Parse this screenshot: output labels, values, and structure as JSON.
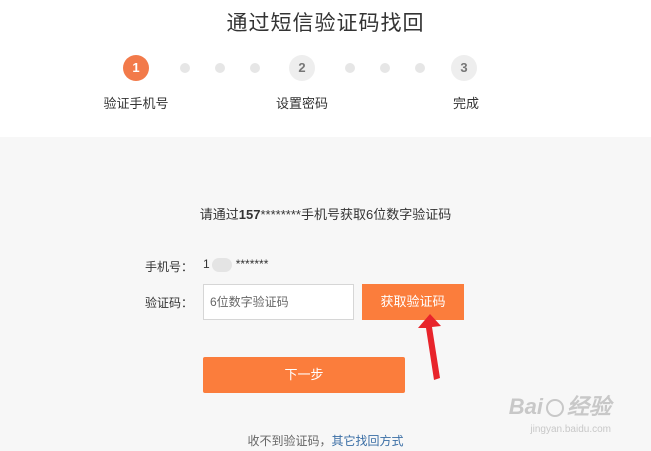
{
  "page": {
    "title": "通过短信验证码找回"
  },
  "steps": [
    {
      "number": "1",
      "label": "验证手机号",
      "state": "active"
    },
    {
      "number": "2",
      "label": "设置密码",
      "state": "inactive"
    },
    {
      "number": "3",
      "label": "完成",
      "state": "inactive"
    }
  ],
  "form": {
    "prompt_prefix": "请通过",
    "prompt_phone": "157",
    "prompt_suffix": "********手机号获取6位数字验证码",
    "phone_label": "手机号：",
    "phone_prefix": "1",
    "phone_masked": "*******",
    "code_label": "验证码：",
    "code_placeholder": "6位数字验证码",
    "code_value": "",
    "get_code_button": "获取验证码",
    "next_button": "下一步"
  },
  "footer": {
    "text": "收不到验证码，",
    "link": "其它找回方式"
  },
  "watermark": {
    "brand": "Bai",
    "brand_suffix": "经验",
    "url": "jingyan.baidu.com"
  },
  "colors": {
    "accent": "#fb7d3c",
    "step_active": "#f27a4a",
    "link": "#3a6ea5",
    "arrow": "#e8242b"
  }
}
